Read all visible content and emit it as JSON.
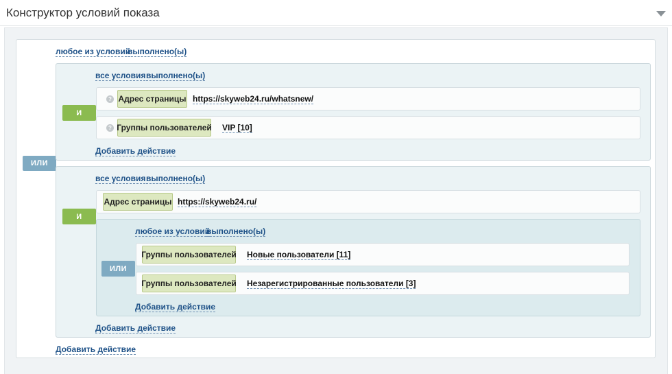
{
  "header": {
    "title": "Конструктор условий показа",
    "collapse_icon": "triangle-down-icon"
  },
  "root": {
    "mode": "любое из условий",
    "state": "выполнено(ы)",
    "join_badge": "ИЛИ",
    "add_action": "Добавить действие"
  },
  "group1": {
    "mode": "все условия",
    "state": "выполнено(ы)",
    "join_badge": "И",
    "conditions": [
      {
        "label": "Адрес страницы",
        "value": "https://skyweb24.ru/whatsnew/"
      },
      {
        "label": "Группы пользователей",
        "value": "VIP [10]"
      }
    ],
    "add_action": "Добавить действие"
  },
  "group2": {
    "mode": "все условия",
    "state": "выполнено(ы)",
    "join_badge": "И",
    "conditions": [
      {
        "label": "Адрес страницы",
        "value": "https://skyweb24.ru/"
      }
    ],
    "subgroup": {
      "mode": "любое из условий",
      "state": "выполнено(ы)",
      "join_badge": "ИЛИ",
      "conditions": [
        {
          "label": "Группы пользователей",
          "value": "Новые пользователи [11]"
        },
        {
          "label": "Группы пользователей",
          "value": "Незарегистрированные пользователи [3]"
        }
      ],
      "add_action": "Добавить действие"
    },
    "add_action": "Добавить действие"
  },
  "colors": {
    "and_badge": "#8bbb50",
    "or_badge": "#7faac2",
    "link": "#1f5288",
    "condition_label_bg": "#dde8c0"
  }
}
